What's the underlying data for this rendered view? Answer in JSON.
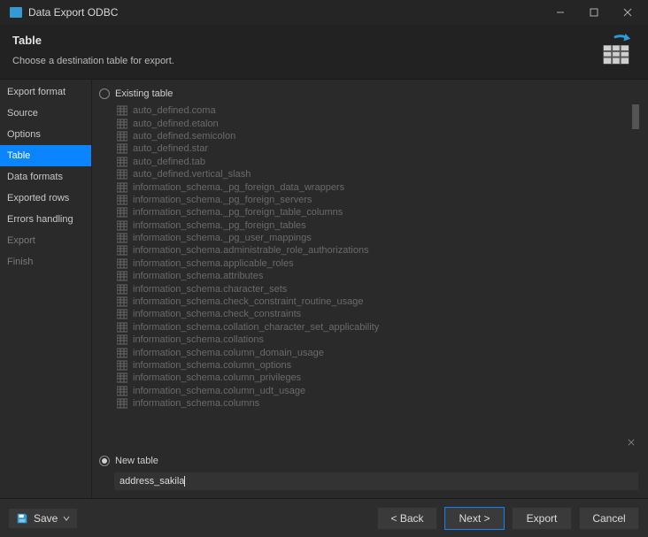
{
  "window": {
    "title": "Data Export ODBC"
  },
  "header": {
    "title": "Table",
    "subtitle": "Choose a destination table for export."
  },
  "sidebar": {
    "items": [
      {
        "label": "Export format",
        "selected": false,
        "muted": false
      },
      {
        "label": "Source",
        "selected": false,
        "muted": false
      },
      {
        "label": "Options",
        "selected": false,
        "muted": false
      },
      {
        "label": "Table",
        "selected": true,
        "muted": false
      },
      {
        "label": "Data formats",
        "selected": false,
        "muted": false
      },
      {
        "label": "Exported rows",
        "selected": false,
        "muted": false
      },
      {
        "label": "Errors handling",
        "selected": false,
        "muted": false
      },
      {
        "label": "Export",
        "selected": false,
        "muted": true
      },
      {
        "label": "Finish",
        "selected": false,
        "muted": true
      }
    ]
  },
  "table_mode": {
    "existing_label": "Existing table",
    "new_label": "New table",
    "selected": "new"
  },
  "existing_tables": [
    "auto_defined.coma",
    "auto_defined.etalon",
    "auto_defined.semicolon",
    "auto_defined.star",
    "auto_defined.tab",
    "auto_defined.vertical_slash",
    "information_schema._pg_foreign_data_wrappers",
    "information_schema._pg_foreign_servers",
    "information_schema._pg_foreign_table_columns",
    "information_schema._pg_foreign_tables",
    "information_schema._pg_user_mappings",
    "information_schema.administrable_role_authorizations",
    "information_schema.applicable_roles",
    "information_schema.attributes",
    "information_schema.character_sets",
    "information_schema.check_constraint_routine_usage",
    "information_schema.check_constraints",
    "information_schema.collation_character_set_applicability",
    "information_schema.collations",
    "information_schema.column_domain_usage",
    "information_schema.column_options",
    "information_schema.column_privileges",
    "information_schema.column_udt_usage",
    "information_schema.columns"
  ],
  "new_table": {
    "value": "address_sakila"
  },
  "footer": {
    "save": "Save",
    "back": "< Back",
    "next": "Next >",
    "export": "Export",
    "cancel": "Cancel"
  }
}
